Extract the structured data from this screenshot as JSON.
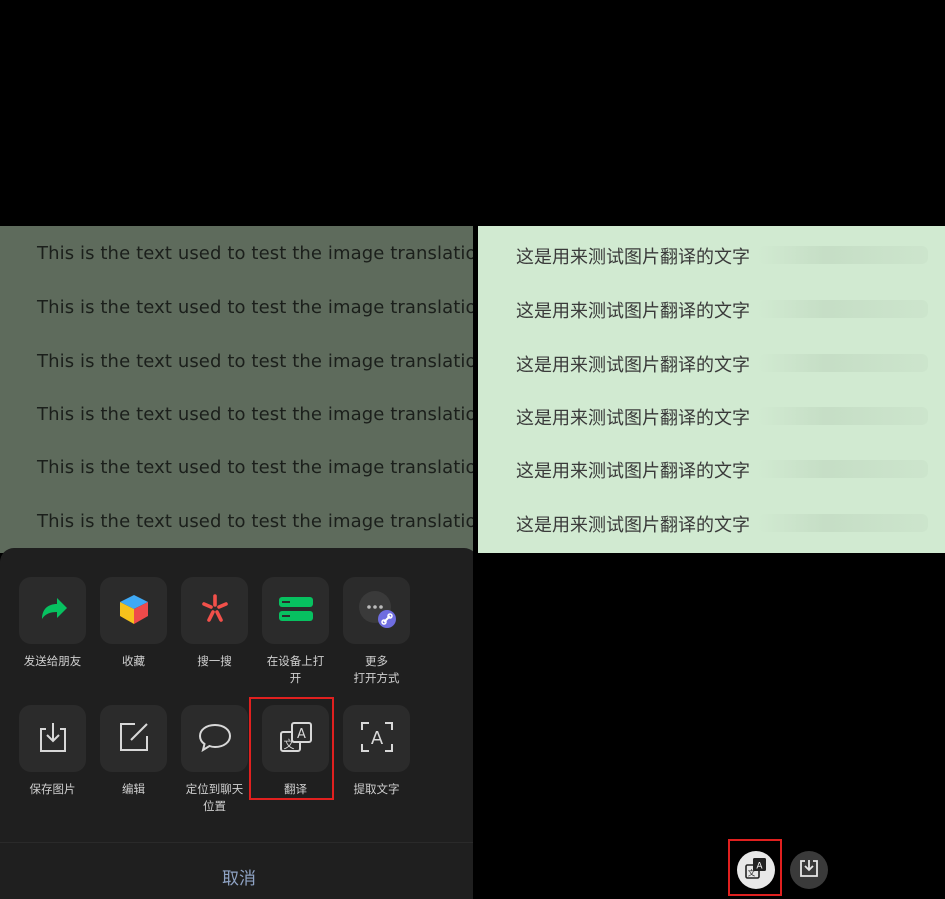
{
  "source_image": {
    "lines": [
      "This is the text used to test the image translation",
      "This is the text used to test the image translation",
      "This is the text used to test the image translation",
      "This is the text used to test the image translation",
      "This is the text used to test the image translation",
      "This is the text used to test the image translation"
    ]
  },
  "translated_image": {
    "lines": [
      "这是用来测试图片翻译的文字",
      "这是用来测试图片翻译的文字",
      "这是用来测试图片翻译的文字",
      "这是用来测试图片翻译的文字",
      "这是用来测试图片翻译的文字",
      "这是用来测试图片翻译的文字"
    ]
  },
  "action_sheet": {
    "row1": [
      {
        "label": "发送给朋友",
        "icon": "forward-arrow-icon"
      },
      {
        "label": "收藏",
        "icon": "favorites-cube-icon"
      },
      {
        "label": "搜一搜",
        "icon": "search-star-icon"
      },
      {
        "label": "在设备上打开",
        "icon": "device-open-icon"
      },
      {
        "label": "更多\n打开方式",
        "icon": "more-open-icon"
      }
    ],
    "row2": [
      {
        "label": "保存图片",
        "icon": "save-image-icon"
      },
      {
        "label": "编辑",
        "icon": "edit-icon"
      },
      {
        "label": "定位到聊天位置",
        "icon": "chat-bubble-icon"
      },
      {
        "label": "翻译",
        "icon": "translate-icon"
      },
      {
        "label": "提取文字",
        "icon": "extract-text-icon"
      }
    ],
    "cancel_label": "取消"
  },
  "colors": {
    "highlight": "#e0201f",
    "wechat_green": "#07c160",
    "sheet_bg": "#1f1f1f"
  }
}
